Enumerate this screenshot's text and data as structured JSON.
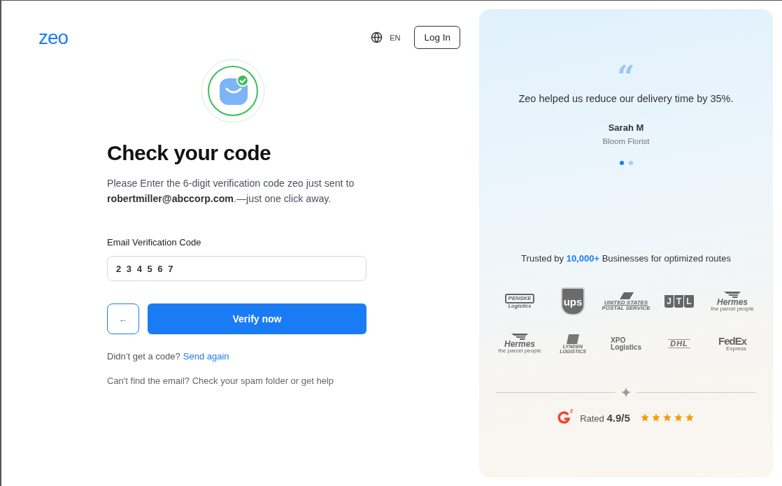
{
  "header": {
    "logo": "zeo",
    "language": "EN",
    "login_button": "Log In"
  },
  "verify": {
    "title": "Check your code",
    "message": "Please Enter the 6-digit verification code zeo just sent to **robertmiller@abccorp.com**.—just one click away.",
    "code_label": "Email Verification Code",
    "code_value": "2 3 4 5 6 7",
    "back_button": "←",
    "verify_button": "Verify now",
    "resend_prompt": "Didn’t get a code?",
    "resend_link": "Send again",
    "help_text": "Can't find the email? Check your spam folder or get help"
  },
  "testimonial": {
    "quote_mark": "“",
    "quote": "Zeo helped us reduce our delivery time by 35%.",
    "author": "Sarah M",
    "company": "Bloom Florist",
    "dots": [
      {
        "selected": true
      },
      {
        "selected": false
      }
    ]
  },
  "trusted": {
    "text": "Trusted by **10,000+** Businesses for optimized routes"
  },
  "logos": [
    {
      "kind": "boxed",
      "lines": [
        "PENSKE",
        "Logistics"
      ]
    },
    {
      "kind": "shield",
      "lines": [
        "ups"
      ]
    },
    {
      "kind": "eagle",
      "lines": [
        "UNITED STATES",
        "POSTAL SERVICE"
      ]
    },
    {
      "kind": "tiles",
      "lines": [
        "J",
        "T",
        "L"
      ]
    },
    {
      "kind": "wing",
      "lines": [
        "Hermes",
        "the parcel people"
      ]
    },
    {
      "kind": "wing",
      "lines": [
        "Hermes",
        "the parcel people"
      ]
    },
    {
      "kind": "block",
      "lines": [
        "LYNDEN",
        "LOGISTICS"
      ]
    },
    {
      "kind": "plain",
      "lines": [
        "XPO",
        "Logistics"
      ]
    },
    {
      "kind": "italic",
      "lines": [
        "DHL"
      ]
    },
    {
      "kind": "fedex",
      "lines": [
        "FedEx",
        "Express"
      ]
    }
  ],
  "rating": {
    "badge": "2",
    "label": "Rated",
    "score": "4.9/5",
    "stars": 5
  }
}
